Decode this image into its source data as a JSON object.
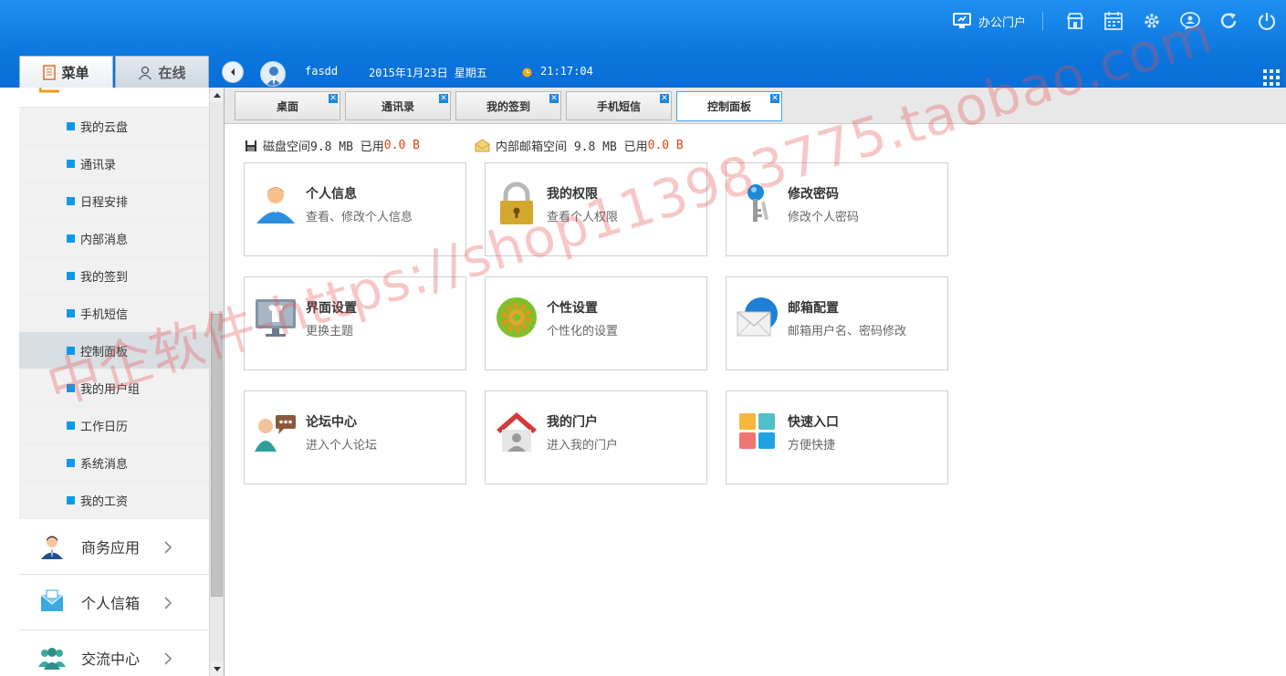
{
  "header": {
    "portal_label": "办公门户",
    "tool_icons": [
      "store-icon",
      "calendar-icon",
      "gear-icon",
      "user-online-icon",
      "refresh-icon",
      "power-icon"
    ]
  },
  "side_tabs": {
    "menu": "菜单",
    "online": "在线"
  },
  "user": {
    "name": "fasdd",
    "date": "2015年1月23日 星期五",
    "time": "21:17:04"
  },
  "sidebar": {
    "sub_items": [
      {
        "label": "我的云盘"
      },
      {
        "label": "通讯录"
      },
      {
        "label": "日程安排"
      },
      {
        "label": "内部消息"
      },
      {
        "label": "我的签到"
      },
      {
        "label": "手机短信"
      },
      {
        "label": "控制面板",
        "active": true
      },
      {
        "label": "我的用户组"
      },
      {
        "label": "工作日历"
      },
      {
        "label": "系统消息"
      },
      {
        "label": "我的工资"
      }
    ],
    "main_items": [
      {
        "label": "商务应用",
        "icon": "business-person-icon"
      },
      {
        "label": "个人信箱",
        "icon": "mailbox-icon"
      },
      {
        "label": "交流中心",
        "icon": "group-icon"
      }
    ]
  },
  "tabs": [
    {
      "label": "桌面"
    },
    {
      "label": "通讯录"
    },
    {
      "label": "我的签到"
    },
    {
      "label": "手机短信"
    },
    {
      "label": "控制面板",
      "active": true
    }
  ],
  "usage": {
    "disk_label": "磁盘空间9.8 MB 已用",
    "disk_used": "0.0 B",
    "mail_label": "内部邮箱空间 9.8 MB 已用",
    "mail_used": "0.0 B"
  },
  "cards": [
    {
      "title": "个人信息",
      "desc": "查看、修改个人信息",
      "icon": "person-icon"
    },
    {
      "title": "我的权限",
      "desc": "查看个人权限",
      "icon": "lock-icon"
    },
    {
      "title": "修改密码",
      "desc": "修改个人密码",
      "icon": "keys-icon"
    },
    {
      "title": "界面设置",
      "desc": "更换主题",
      "icon": "monitor-shirt-icon"
    },
    {
      "title": "个性设置",
      "desc": "个性化的设置",
      "icon": "gear-icon"
    },
    {
      "title": "邮箱配置",
      "desc": "邮箱用户名、密码修改",
      "icon": "envelope-icon"
    },
    {
      "title": "论坛中心",
      "desc": "进入个人论坛",
      "icon": "forum-chat-icon"
    },
    {
      "title": "我的门户",
      "desc": "进入我的门户",
      "icon": "home-portal-icon"
    },
    {
      "title": "快速入口",
      "desc": "方便快捷",
      "icon": "tiles-icon"
    }
  ],
  "watermark": "中企软件-https://shop113983775.taobao.com",
  "colors": {
    "header_blue": "#0a73dc",
    "accent_blue": "#0b9ae8",
    "used_red": "#e2420d"
  }
}
